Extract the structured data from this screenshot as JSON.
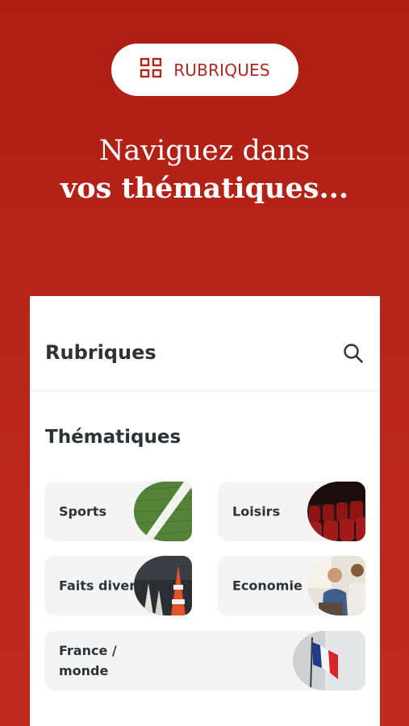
{
  "hero": {
    "pill_label": "RUBRIQUES",
    "pill_icon": "grid-icon",
    "headline_line1": "Naviguez dans",
    "headline_line2": "vos thématiques..."
  },
  "panel": {
    "title": "Rubriques",
    "search_icon": "search-icon",
    "section_title": "Thématiques",
    "cards": [
      {
        "label": "Sports",
        "image": "football-pitch-line"
      },
      {
        "label": "Loisirs",
        "image": "theater-seats"
      },
      {
        "label": "Faits divers",
        "image": "traffic-cones"
      },
      {
        "label": "Economie",
        "image": "business-meeting"
      },
      {
        "label": "France / monde",
        "image": "french-flag"
      }
    ]
  },
  "colors": {
    "background": "#b8261a",
    "accent": "#b3261b",
    "text_dark": "#2c3236",
    "card_bg": "#f4f4f5"
  }
}
